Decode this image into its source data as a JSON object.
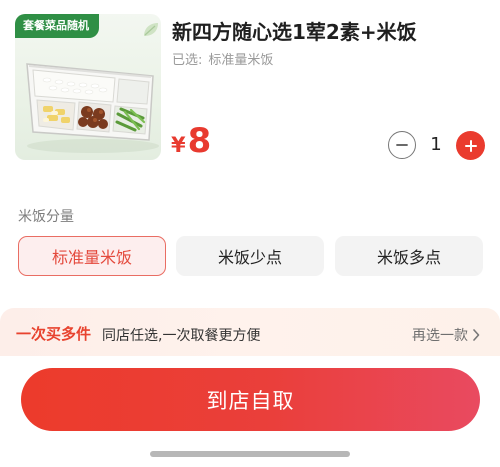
{
  "product": {
    "image_badge": "套餐菜品随机",
    "title": "新四方随心选1荤2素+米饭",
    "selected_label": "已选:",
    "selected_value": "标准量米饭",
    "currency": "¥",
    "price": "8"
  },
  "stepper": {
    "quantity": "1"
  },
  "options": {
    "section_label": "米饭分量",
    "items": [
      {
        "label": "标准量米饭",
        "selected": true
      },
      {
        "label": "米饭少点",
        "selected": false
      },
      {
        "label": "米饭多点",
        "selected": false
      }
    ]
  },
  "promo": {
    "title": "一次买多件",
    "description": "同店任选,一次取餐更方便",
    "link_label": "再选一款"
  },
  "cta": {
    "label": "到店自取"
  },
  "colors": {
    "accent": "#ea3b2e",
    "badge_green": "#2f8f45"
  },
  "icons": [
    "minus-icon",
    "plus-icon",
    "chevron-right-icon",
    "leaf-icon"
  ]
}
